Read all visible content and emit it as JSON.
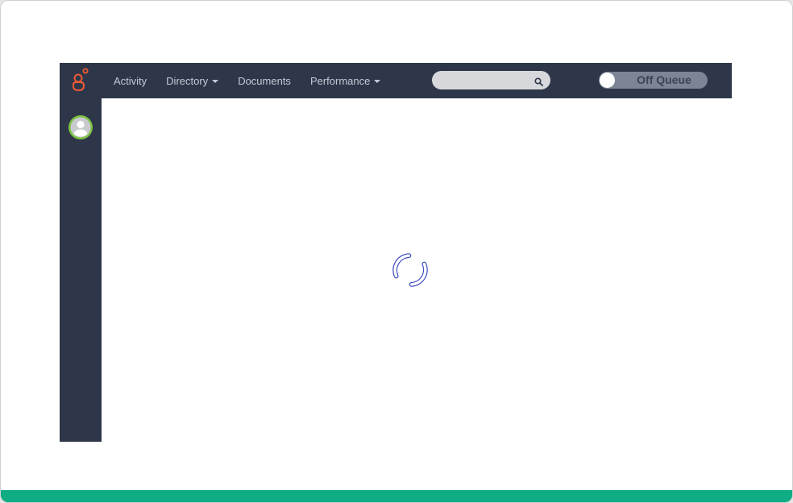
{
  "nav": {
    "items": [
      {
        "label": "Activity",
        "dropdown": false
      },
      {
        "label": "Directory",
        "dropdown": true
      },
      {
        "label": "Documents",
        "dropdown": false
      },
      {
        "label": "Performance",
        "dropdown": true
      }
    ]
  },
  "search": {
    "value": "",
    "placeholder": "",
    "icon": "search-icon"
  },
  "queue": {
    "label": "Off Queue",
    "state": "off"
  },
  "logo": {
    "icon": "genesys-logo",
    "color": "#ee5a34"
  },
  "avatar": {
    "icon": "user-avatar",
    "ring_color": "#7cc242"
  },
  "main": {
    "status": "loading",
    "spinner_icon": "loading-spinner-icon",
    "spinner_color": "#3b4cc0"
  },
  "theme": {
    "nav_background": "#2e3749",
    "footer_accent": "#10ac84"
  }
}
